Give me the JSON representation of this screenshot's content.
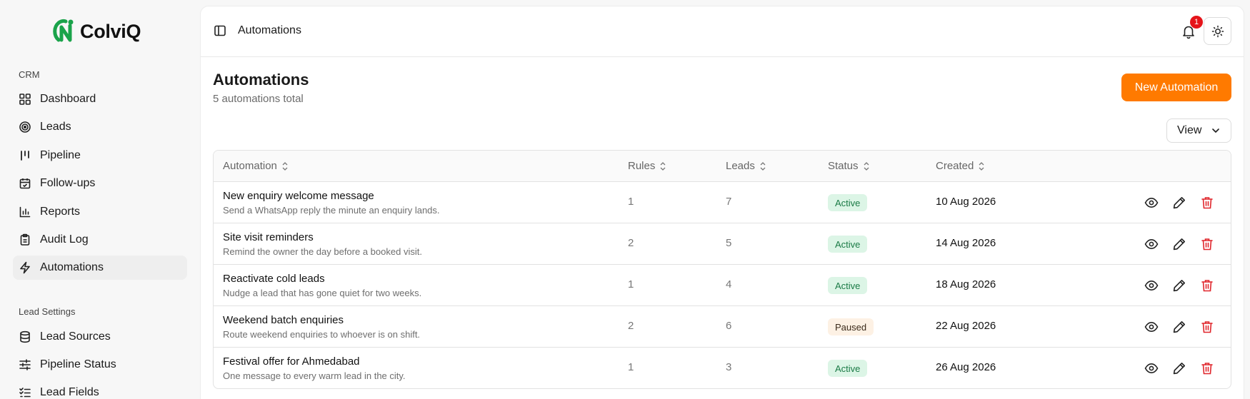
{
  "brand": {
    "name": "ColviQ",
    "accent": "#ff7a00",
    "logo_green": "#1aa34a"
  },
  "sidebar": {
    "sections": [
      {
        "title": "CRM"
      },
      {
        "title": "Lead Settings"
      }
    ],
    "crm_items": [
      {
        "label": "Dashboard",
        "icon": "dashboard-icon"
      },
      {
        "label": "Leads",
        "icon": "target-icon"
      },
      {
        "label": "Pipeline",
        "icon": "pipeline-icon"
      },
      {
        "label": "Follow-ups",
        "icon": "calendar-icon"
      },
      {
        "label": "Reports",
        "icon": "bar-chart-icon"
      },
      {
        "label": "Audit Log",
        "icon": "clipboard-icon"
      },
      {
        "label": "Automations",
        "icon": "bolt-icon",
        "active": true
      }
    ],
    "settings_items": [
      {
        "label": "Lead Sources",
        "icon": "database-icon"
      },
      {
        "label": "Pipeline Status",
        "icon": "sliders-icon"
      },
      {
        "label": "Lead Fields",
        "icon": "list-check-icon"
      }
    ]
  },
  "topbar": {
    "title": "Automations",
    "notification_count": "1"
  },
  "page": {
    "title": "Automations",
    "subtitle": "5 automations total",
    "new_button": "New Automation",
    "view_button": "View"
  },
  "table": {
    "columns": [
      "Automation",
      "Rules",
      "Leads",
      "Status",
      "Created"
    ],
    "rows": [
      {
        "name": "New enquiry welcome message",
        "desc": "Send a WhatsApp reply the minute an enquiry lands.",
        "rules": "1",
        "leads": "7",
        "status": "Active",
        "created": "10 Aug 2026"
      },
      {
        "name": "Site visit reminders",
        "desc": "Remind the owner the day before a booked visit.",
        "rules": "2",
        "leads": "5",
        "status": "Active",
        "created": "14 Aug 2026"
      },
      {
        "name": "Reactivate cold leads",
        "desc": "Nudge a lead that has gone quiet for two weeks.",
        "rules": "1",
        "leads": "4",
        "status": "Active",
        "created": "18 Aug 2026"
      },
      {
        "name": "Weekend batch enquiries",
        "desc": "Route weekend enquiries to whoever is on shift.",
        "rules": "2",
        "leads": "6",
        "status": "Paused",
        "created": "22 Aug 2026"
      },
      {
        "name": "Festival offer for Ahmedabad",
        "desc": "One message to every warm lead in the city.",
        "rules": "1",
        "leads": "3",
        "status": "Active",
        "created": "26 Aug 2026"
      }
    ]
  }
}
